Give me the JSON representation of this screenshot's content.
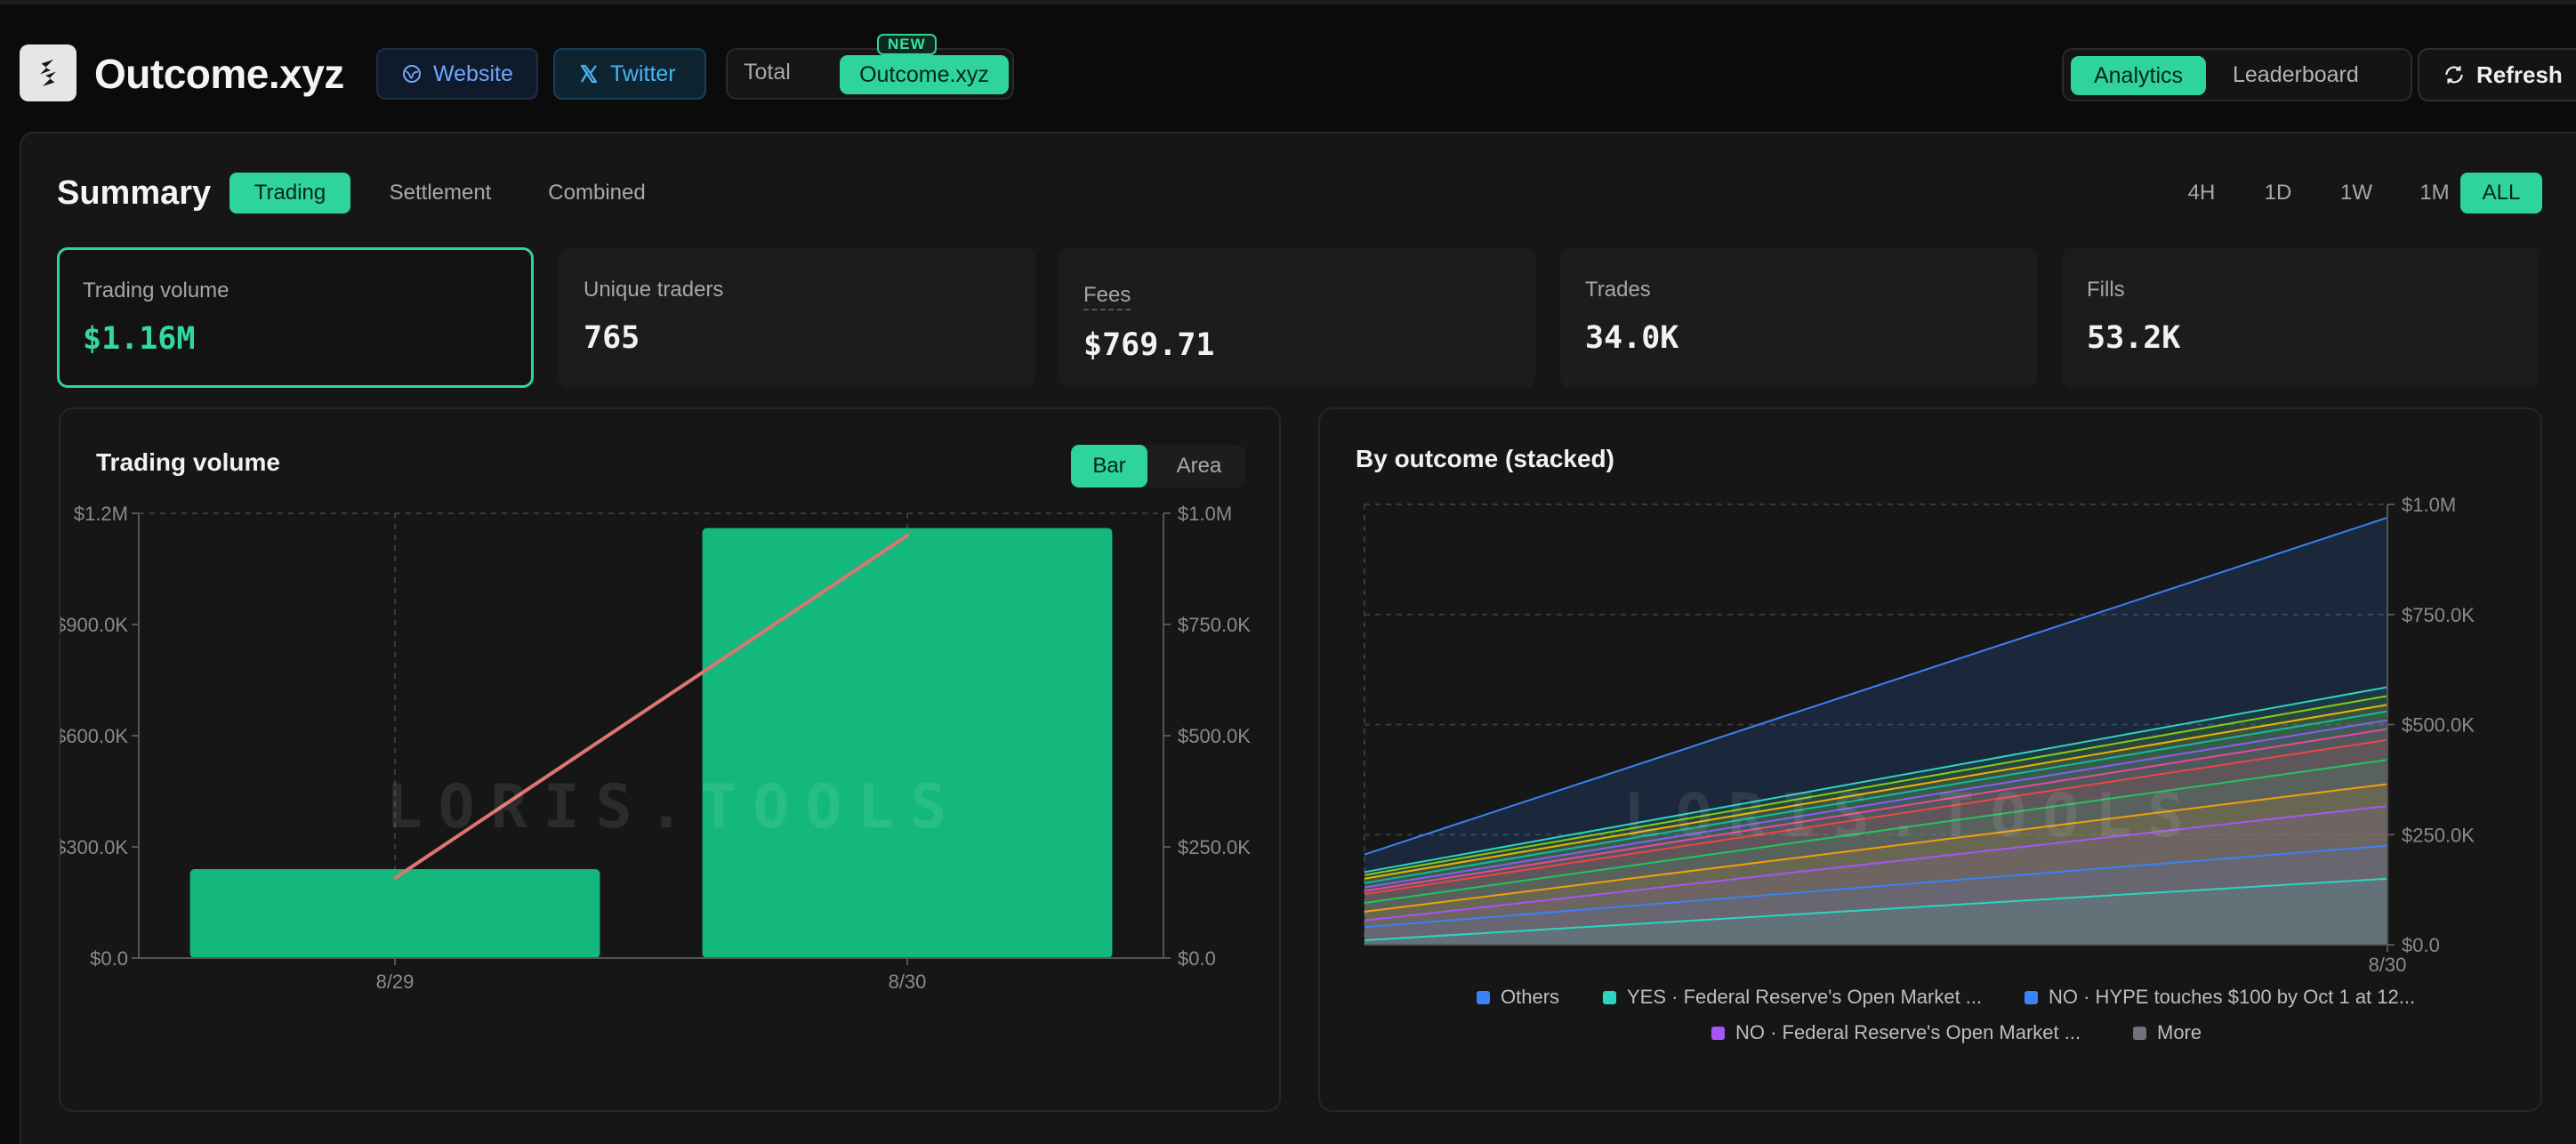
{
  "header": {
    "title": "Outcome.xyz",
    "website_label": "Website",
    "twitter_label": "Twitter",
    "scope_total": "Total",
    "scope_outcome": "Outcome.xyz",
    "new_badge": "NEW",
    "nav_analytics": "Analytics",
    "nav_leaderboard": "Leaderboard",
    "refresh_label": "Refresh"
  },
  "summary": {
    "title": "Summary",
    "tabs": [
      "Trading",
      "Settlement",
      "Combined"
    ],
    "ranges": [
      "4H",
      "1D",
      "1W",
      "1M",
      "ALL"
    ],
    "kpis": [
      {
        "label": "Trading volume",
        "value": "$1.16M"
      },
      {
        "label": "Unique traders",
        "value": "765"
      },
      {
        "label": "Fees",
        "value": "$769.71"
      },
      {
        "label": "Trades",
        "value": "34.0K"
      },
      {
        "label": "Fills",
        "value": "53.2K"
      }
    ]
  },
  "watermark": "LORIS.TOOLS",
  "volume_chart": {
    "title": "Trading volume",
    "toggle_bar": "Bar",
    "toggle_area": "Area"
  },
  "outcome_chart": {
    "title": "By outcome (stacked)",
    "legend": [
      {
        "label": "Others",
        "color": "#3b82f6"
      },
      {
        "label": "YES · Federal Reserve's Open Market ...",
        "color": "#2dd4bf"
      },
      {
        "label": "NO · HYPE touches $100 by Oct 1 at 12...",
        "color": "#3b82f6"
      },
      {
        "label": "NO · Federal Reserve's Open Market ...",
        "color": "#a855f7"
      },
      {
        "label": "More",
        "color": "#71717a"
      }
    ]
  },
  "chart_data": [
    {
      "type": "bar",
      "title": "Trading volume",
      "categories": [
        "8/29",
        "8/30"
      ],
      "series": [
        {
          "type": "bar",
          "values": [
            240000,
            1160000
          ],
          "color": "#14b87d"
        },
        {
          "type": "line",
          "values": [
            180000,
            950000
          ],
          "color": "#dc7575"
        }
      ],
      "ylim": [
        0,
        1200000
      ],
      "y_ticks": [
        "$0.0",
        "$300.0K",
        "$600.0K",
        "$900.0K",
        "$1.2M"
      ],
      "y2lim": [
        0,
        1000000
      ],
      "y2_ticks": [
        "$0.0",
        "$250.0K",
        "$500.0K",
        "$750.0K",
        "$1.0M"
      ],
      "grid": true
    },
    {
      "type": "area",
      "title": "By outcome (stacked)",
      "categories": [
        "8/30"
      ],
      "x_ticks": [
        "8/30"
      ],
      "ylim": [
        0,
        1000000
      ],
      "y_ticks": [
        "$0.0",
        "$250.0K",
        "$500.0K",
        "$750.0K",
        "$1.0M"
      ],
      "stacked_totals_start": [
        10000,
        40000,
        55000,
        75000,
        95000,
        115000,
        122000,
        130000,
        140000,
        150000,
        158000,
        165000,
        205000
      ],
      "stacked_totals_end": [
        150000,
        225000,
        315000,
        365000,
        420000,
        465000,
        490000,
        510000,
        530000,
        545000,
        565000,
        585000,
        970000
      ],
      "layer_colors": [
        "#2dd4bf",
        "#3b82f6",
        "#a855f7",
        "#f59e0b",
        "#22c55e",
        "#ef4444",
        "#ec4899",
        "#8b5cf6",
        "#14b8a6",
        "#eab308",
        "#84cc16",
        "#2dd4bf",
        "#3b82f6"
      ],
      "legend_position": "bottom",
      "grid": true
    }
  ]
}
